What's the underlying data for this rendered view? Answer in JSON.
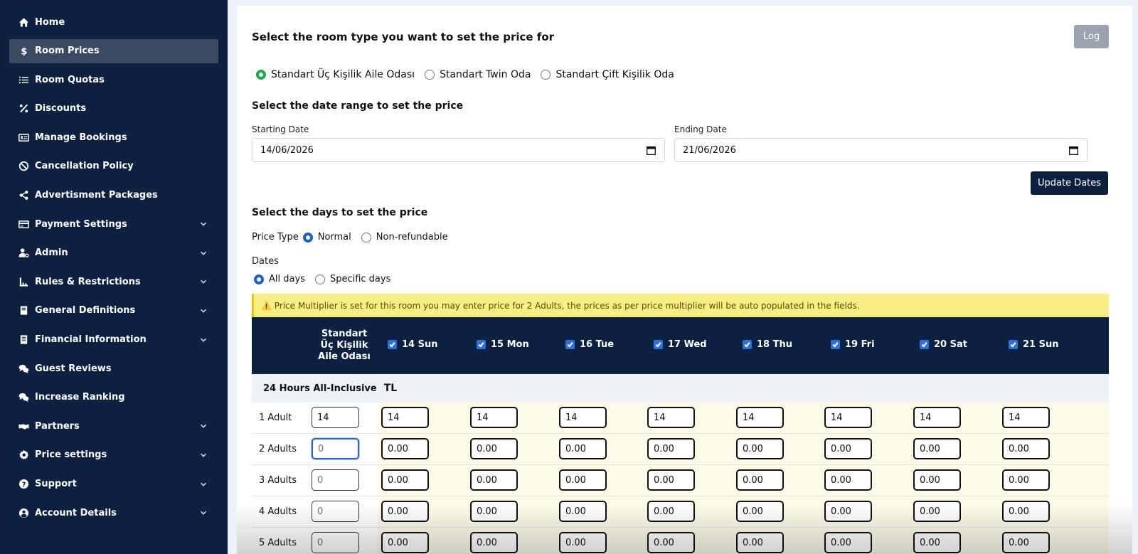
{
  "sidebar": {
    "items": [
      {
        "label": "Home",
        "icon": "home-icon",
        "active": false,
        "chevron": false
      },
      {
        "label": "Room Prices",
        "icon": "dollar-icon",
        "active": true,
        "chevron": false
      },
      {
        "label": "Room Quotas",
        "icon": "list-icon",
        "active": false,
        "chevron": false
      },
      {
        "label": "Discounts",
        "icon": "percent-icon",
        "active": false,
        "chevron": false
      },
      {
        "label": "Manage Bookings",
        "icon": "id-card-icon",
        "active": false,
        "chevron": false
      },
      {
        "label": "Cancellation Policy",
        "icon": "ban-icon",
        "active": false,
        "chevron": false
      },
      {
        "label": "Advertisment Packages",
        "icon": "share-icon",
        "active": false,
        "chevron": false
      },
      {
        "label": "Payment Settings",
        "icon": "credit-card-icon",
        "active": false,
        "chevron": true
      },
      {
        "label": "Admin",
        "icon": "user-cog-icon",
        "active": false,
        "chevron": true
      },
      {
        "label": "Rules & Restrictions",
        "icon": "rules-icon",
        "active": false,
        "chevron": true
      },
      {
        "label": "General Definitions",
        "icon": "book-icon",
        "active": false,
        "chevron": true
      },
      {
        "label": "Financial Information",
        "icon": "document-icon",
        "active": false,
        "chevron": true
      },
      {
        "label": "Guest Reviews",
        "icon": "comments-icon",
        "active": false,
        "chevron": false
      },
      {
        "label": "Increase Ranking",
        "icon": "comments-icon",
        "active": false,
        "chevron": false
      },
      {
        "label": "Partners",
        "icon": "handshake-icon",
        "active": false,
        "chevron": true
      },
      {
        "label": "Price settings",
        "icon": "gear-icon",
        "active": false,
        "chevron": true
      },
      {
        "label": "Support",
        "icon": "question-icon",
        "active": false,
        "chevron": true
      },
      {
        "label": "Account Details",
        "icon": "user-circle-icon",
        "active": false,
        "chevron": true
      }
    ]
  },
  "main": {
    "room_type_title": "Select the room type you want to set the price for",
    "log_label": "Log",
    "room_types": [
      "Standart Üç Kişilik Aile Odası",
      "Standart Twin Oda",
      "Standart Çift Kişilik Oda"
    ],
    "selected_room_type": 0,
    "date_range_title": "Select the date range to set the price",
    "starting_date_label": "Starting Date",
    "starting_date": "14/06/2026",
    "ending_date_label": "Ending Date",
    "ending_date": "21/06/2026",
    "update_dates_label": "Update Dates",
    "days_title": "Select the days to set the price",
    "price_type_label": "Price Type",
    "price_types": [
      "Normal",
      "Non-refundable"
    ],
    "dates_label": "Dates",
    "date_options": [
      "All days",
      "Specific days"
    ],
    "alert": "⚠️ Price Multiplier is set for this room you may enter price for 2 Adults, the prices as per price multiplier will be auto populated in the fields."
  },
  "table": {
    "room_header": "Standart Üç Kişilik Aile Odası",
    "days": [
      "14 Sun",
      "15 Mon",
      "16 Tue",
      "17 Wed",
      "18 Thu",
      "19 Fri",
      "20 Sat",
      "21 Sun"
    ],
    "section": "24 Hours All-Inclusive",
    "currency": "TL",
    "rows": [
      {
        "label": "1 Adult",
        "base": "14",
        "base_placeholder": "",
        "values": [
          "14",
          "14",
          "14",
          "14",
          "14",
          "14",
          "14",
          "14"
        ]
      },
      {
        "label": "2 Adults",
        "base": "",
        "base_placeholder": "0",
        "values": [
          "0.00",
          "0.00",
          "0.00",
          "0.00",
          "0.00",
          "0.00",
          "0.00",
          "0.00"
        ]
      },
      {
        "label": "3 Adults",
        "base": "",
        "base_placeholder": "0",
        "values": [
          "0.00",
          "0.00",
          "0.00",
          "0.00",
          "0.00",
          "0.00",
          "0.00",
          "0.00"
        ]
      },
      {
        "label": "4 Adults",
        "base": "",
        "base_placeholder": "0",
        "values": [
          "0.00",
          "0.00",
          "0.00",
          "0.00",
          "0.00",
          "0.00",
          "0.00",
          "0.00"
        ]
      },
      {
        "label": "5 Adults",
        "base": "",
        "base_placeholder": "0",
        "values": [
          "0.00",
          "0.00",
          "0.00",
          "0.00",
          "0.00",
          "0.00",
          "0.00",
          "0.00"
        ]
      }
    ]
  },
  "colors": {
    "sidebar_bg": "#0b213f",
    "active_item_bg": "#3a4a60",
    "accent_green": "#1aab4c",
    "accent_blue": "#1e5fd0",
    "alert_bg": "#f8ee84"
  }
}
